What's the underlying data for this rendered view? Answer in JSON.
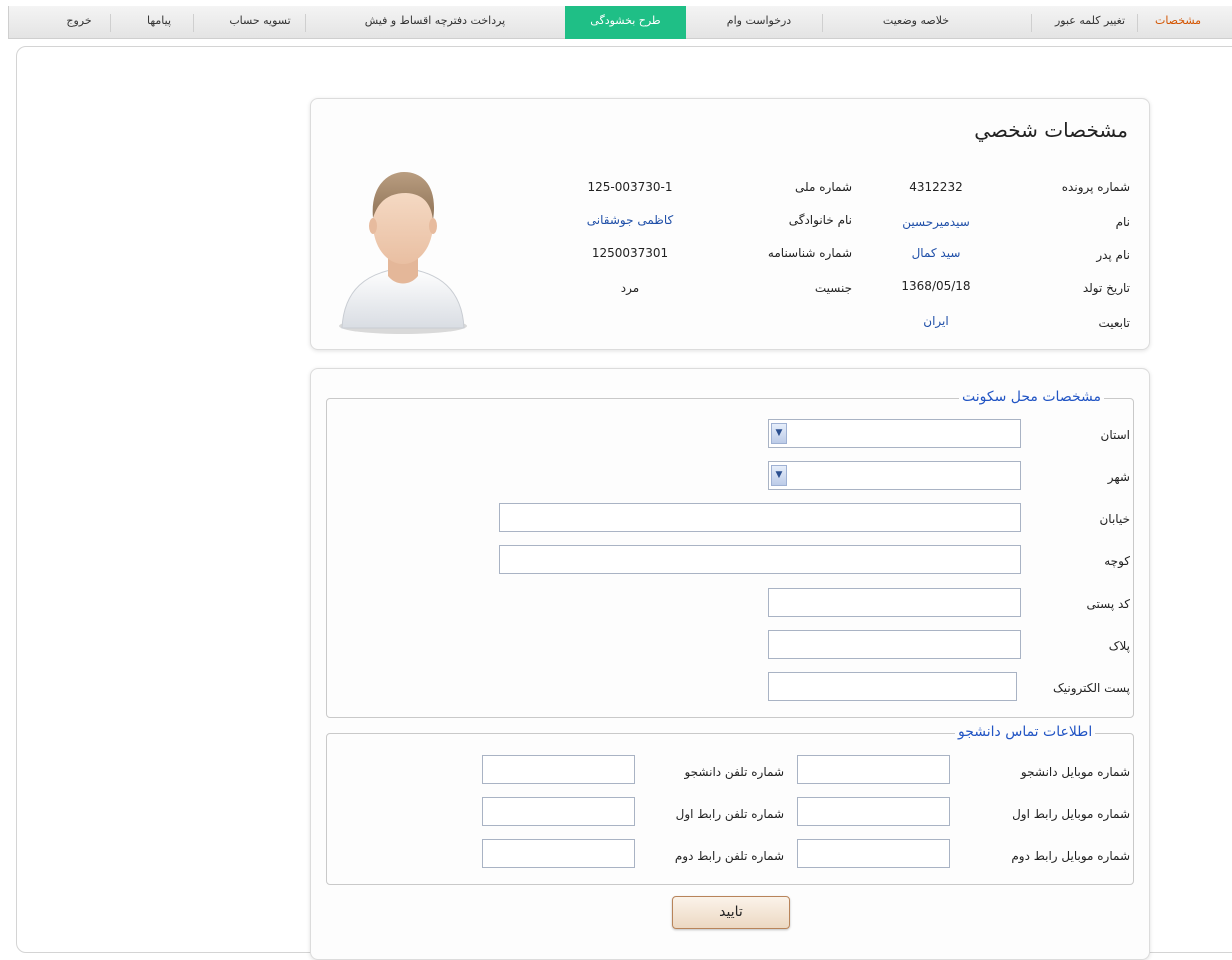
{
  "nav": [
    {
      "label": "مشخصات"
    },
    {
      "label": "تغییر کلمه عبور"
    },
    {
      "label": "خلاصه وضعیت"
    },
    {
      "label": "درخواست وام"
    },
    {
      "label": "طرح بخشودگی"
    },
    {
      "label": "پرداخت دفترچه اقساط و فیش"
    },
    {
      "label": "تسویه حساب"
    },
    {
      "label": "پیامها"
    },
    {
      "label": "خروج"
    }
  ],
  "colors": {
    "active_tab": "#1fbf86",
    "first_tab": "#d35400",
    "link_value": "#1f4fa8",
    "legend": "#2255c4"
  },
  "personal": {
    "title": "مشخصات شخصي",
    "file_no": {
      "label": "شماره پرونده",
      "value": "4312232"
    },
    "national_id": {
      "label": "شماره ملی",
      "value": "125-003730-1"
    },
    "first_name": {
      "label": "نام",
      "value": "سیدمیرحسین"
    },
    "last_name": {
      "label": "نام خانوادگی",
      "value": "کاظمی جوشقانی"
    },
    "father_name": {
      "label": "نام پدر",
      "value": "سید کمال"
    },
    "id_no": {
      "label": "شماره شناسنامه",
      "value": "1250037301"
    },
    "birth_date": {
      "label": "تاریخ تولد",
      "value": "1368/05/18"
    },
    "gender": {
      "label": "جنسیت",
      "value": "مرد"
    },
    "nationality": {
      "label": "تابعیت",
      "value": "ایران"
    }
  },
  "residence": {
    "legend": "مشخصات محل سکونت",
    "province": {
      "label": "استان",
      "value": ""
    },
    "city": {
      "label": "شهر",
      "value": ""
    },
    "street": {
      "label": "خیابان",
      "value": ""
    },
    "alley": {
      "label": "کوچه",
      "value": ""
    },
    "postal_code": {
      "label": "کد پستی",
      "value": ""
    },
    "plaque": {
      "label": "پلاک",
      "value": ""
    },
    "email": {
      "label": "پست الکترونیک",
      "value": ""
    }
  },
  "contact": {
    "legend": "اطلاعات تماس دانشجو",
    "student_mobile": {
      "label": "شماره موبایل دانشجو",
      "value": ""
    },
    "student_phone": {
      "label": "شماره تلفن دانشجو",
      "value": ""
    },
    "contact1_mobile": {
      "label": "شماره موبایل رابط اول",
      "value": ""
    },
    "contact1_phone": {
      "label": "شماره تلفن رابط اول",
      "value": ""
    },
    "contact2_mobile": {
      "label": "شماره موبایل رابط دوم",
      "value": ""
    },
    "contact2_phone": {
      "label": "شماره تلفن رابط دوم",
      "value": ""
    }
  },
  "submit": {
    "label": "تایید"
  }
}
